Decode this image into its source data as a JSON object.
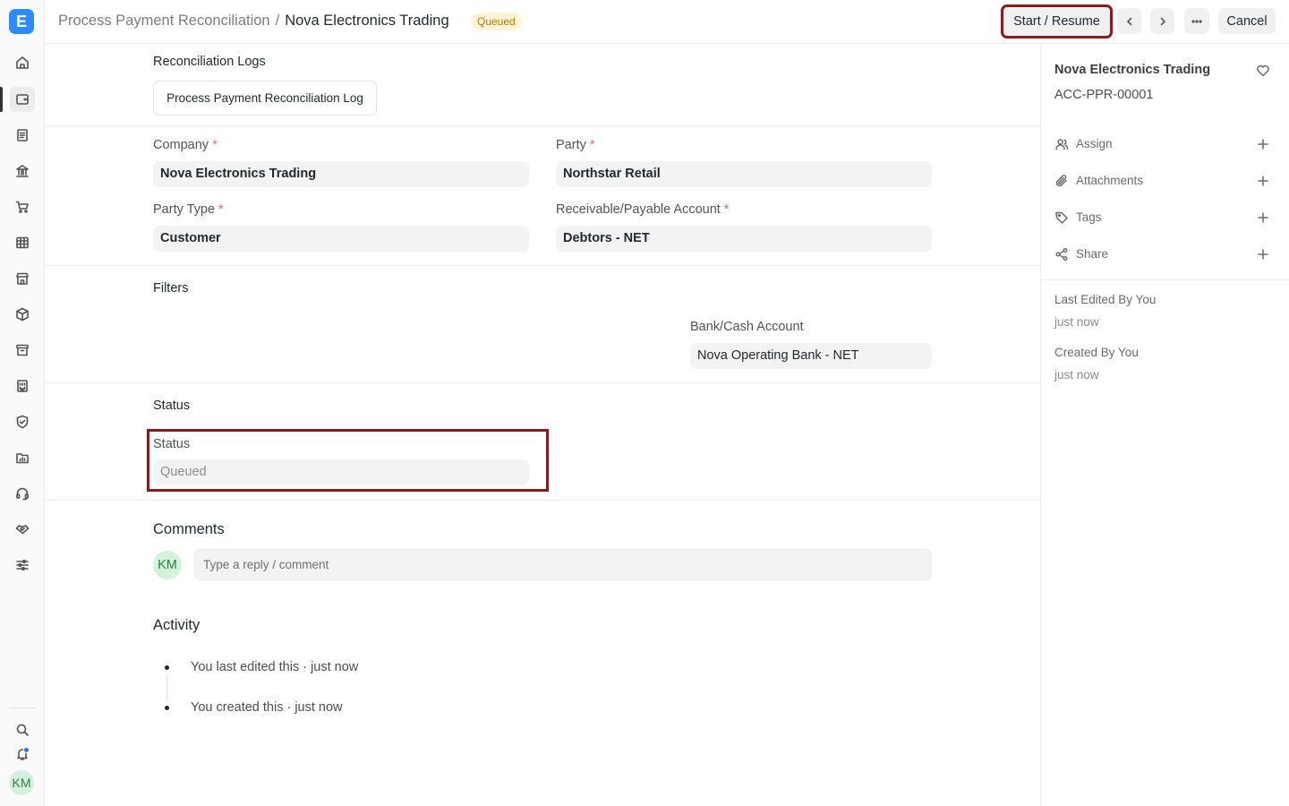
{
  "app": {
    "logo_letter": "E"
  },
  "sidebar": {
    "icons": [
      "home-icon",
      "wallet-icon",
      "document-icon",
      "bank-icon",
      "cart-icon",
      "table-icon",
      "store-icon",
      "package-icon",
      "archive-icon",
      "building-icon",
      "shield-icon",
      "folder-chart-icon",
      "headset-icon",
      "handshake-icon",
      "sliders-icon"
    ],
    "active_index": 1,
    "bottom_icons": [
      "search-icon",
      "bell-icon"
    ],
    "user_initials": "KM"
  },
  "header": {
    "breadcrumb_parent": "Process Payment Reconciliation",
    "breadcrumb_separator": "/",
    "doc_title": "Nova Electronics Trading",
    "status_badge": "Queued",
    "start_resume_label": "Start / Resume",
    "cancel_label": "Cancel"
  },
  "form": {
    "reconciliation_logs": {
      "title": "Reconciliation Logs",
      "log_button": "Process Payment Reconciliation Log"
    },
    "company": {
      "label": "Company",
      "value": "Nova Electronics Trading"
    },
    "party": {
      "label": "Party",
      "value": "Northstar Retail"
    },
    "party_type": {
      "label": "Party Type",
      "value": "Customer"
    },
    "account": {
      "label": "Receivable/Payable Account",
      "value": "Debtors - NET"
    },
    "required_mark": "*",
    "filters": {
      "title": "Filters",
      "bank_label": "Bank/Cash Account",
      "bank_value": "Nova Operating Bank - NET"
    },
    "status_section": {
      "title": "Status",
      "label": "Status",
      "value": "Queued"
    }
  },
  "comments": {
    "title": "Comments",
    "avatar_initials": "KM",
    "placeholder": "Type a reply / comment"
  },
  "activity": {
    "title": "Activity",
    "items": [
      "You last edited this · just now",
      "You created this · just now"
    ]
  },
  "right_panel": {
    "title": "Nova Electronics Trading",
    "doc_id": "ACC-PPR-00001",
    "actions": [
      {
        "label": "Assign",
        "icon": "user-icon"
      },
      {
        "label": "Attachments",
        "icon": "paperclip-icon"
      },
      {
        "label": "Tags",
        "icon": "tag-icon"
      },
      {
        "label": "Share",
        "icon": "share-icon"
      }
    ],
    "last_edited_label": "Last Edited By You",
    "last_edited_time": "just now",
    "created_label": "Created By You",
    "created_time": "just now"
  },
  "colors": {
    "accent": "#2c8cff",
    "highlight_border": "#8b1a1a",
    "badge_bg": "#fff4d6",
    "badge_text": "#b27a00",
    "required": "#e26a6a"
  }
}
